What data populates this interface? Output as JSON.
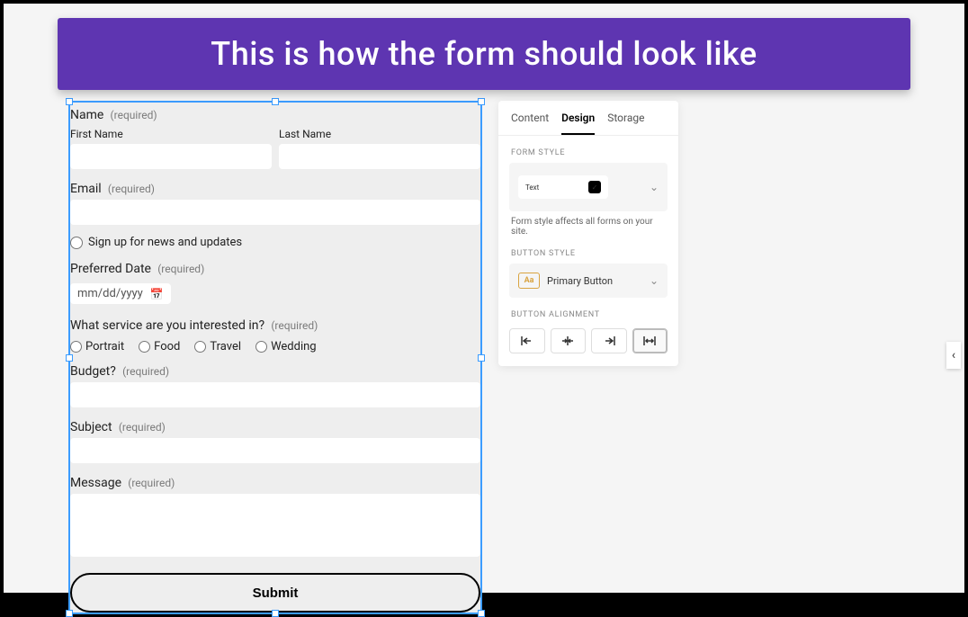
{
  "banner": {
    "title": "This is how the form should look like"
  },
  "form": {
    "required_label": "(required)",
    "name": {
      "label": "Name",
      "first_label": "First Name",
      "last_label": "Last Name"
    },
    "email": {
      "label": "Email"
    },
    "signup": {
      "label": "Sign up for news and updates"
    },
    "date": {
      "label": "Preferred Date",
      "placeholder": "mm/dd/yyyy"
    },
    "service": {
      "label": "What service are you interested in?",
      "options": [
        "Portrait",
        "Food",
        "Travel",
        "Wedding"
      ]
    },
    "budget": {
      "label": "Budget?"
    },
    "subject": {
      "label": "Subject"
    },
    "message": {
      "label": "Message"
    },
    "submit": "Submit"
  },
  "panel": {
    "tabs": {
      "content": "Content",
      "design": "Design",
      "storage": "Storage"
    },
    "form_style": {
      "label": "FORM STYLE",
      "preview_text": "Text",
      "hint": "Form style affects all forms on your site."
    },
    "button_style": {
      "label": "BUTTON STYLE",
      "icon_text": "Aa",
      "value": "Primary Button"
    },
    "alignment": {
      "label": "BUTTON ALIGNMENT"
    }
  }
}
